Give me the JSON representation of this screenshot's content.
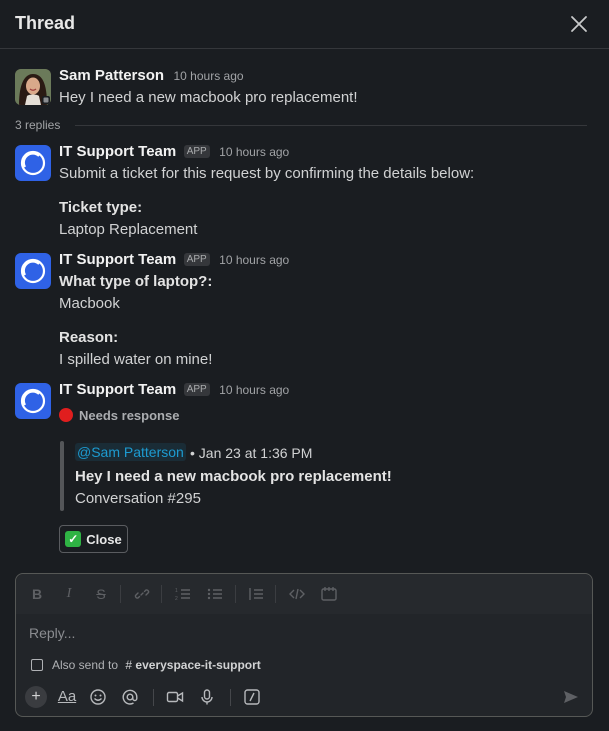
{
  "header": {
    "title": "Thread"
  },
  "parent": {
    "author": "Sam Patterson",
    "time": "10 hours ago",
    "text": "Hey I need a new macbook pro replacement!"
  },
  "replies_label": "3 replies",
  "reply1": {
    "author": "IT Support Team",
    "badge": "APP",
    "time": "10 hours ago",
    "text": "Submit a ticket for this request by confirming the details below:",
    "field_label": "Ticket type:",
    "field_value": "Laptop Replacement"
  },
  "reply2": {
    "author": "IT Support Team",
    "badge": "APP",
    "time": "10 hours ago",
    "q1_label": "What type of laptop?:",
    "q1_value": "Macbook",
    "q2_label": "Reason:",
    "q2_value": "I spilled water on mine!"
  },
  "reply3": {
    "author": "IT Support Team",
    "badge": "APP",
    "time": "10 hours ago",
    "status": "Needs response",
    "status_color": "#e01e1e",
    "quote": {
      "mention": "@Sam Patterson",
      "date": "• Jan 23 at 1:36 PM",
      "title": "Hey I need a new macbook pro replacement!",
      "conversation": "Conversation #295"
    },
    "close_label": "Close"
  },
  "composer": {
    "placeholder": "Reply...",
    "also_send": "Also send to",
    "channel_prefix": "#",
    "channel": "everyspace-it-support",
    "format_label": "Aa"
  },
  "colors": {
    "background": "#1a1d21",
    "mention": "#1d9bd1",
    "app_avatar": "#2f62e6",
    "check": "#2fb344"
  }
}
